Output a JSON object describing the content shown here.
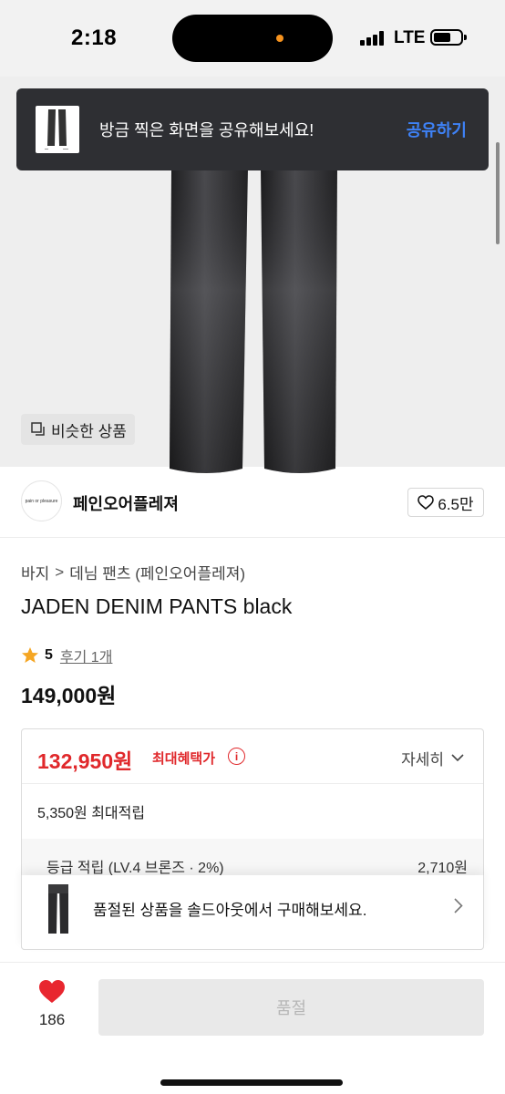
{
  "status_bar": {
    "time": "2:18",
    "network": "LTE"
  },
  "toast": {
    "message": "방금 찍은 화면을 공유해보세요!",
    "action": "공유하기"
  },
  "image_area": {
    "similar_label": "비슷한 상품"
  },
  "brand": {
    "logo_text": "pain or pleasure",
    "name": "페인오어플레져",
    "likes": "6.5만"
  },
  "breadcrumb": {
    "category": "바지",
    "separator": ">",
    "subcategory": "데님 팬츠 (페인오어플레져)"
  },
  "product": {
    "title": "JADEN DENIM PANTS black",
    "rating": "5",
    "reviews": "후기 1개",
    "price": "149,000원"
  },
  "benefit": {
    "price": "132,950원",
    "label": "최대혜택가",
    "info_symbol": "i",
    "detail": "자세히",
    "points": "5,350원 최대적립",
    "grade_text": "등급 적립 (LV.4 브론즈 · 2%)",
    "grade_value": "2,710원"
  },
  "soldout_banner": {
    "text": "품절된 상품을 솔드아웃에서 구매해보세요."
  },
  "bottom_bar": {
    "wish_count": "186",
    "button_label": "품절"
  },
  "colors": {
    "accent_red": "#e0282b",
    "link_blue": "#3e82f7",
    "star": "#f5a623",
    "heart": "#e8262f"
  }
}
